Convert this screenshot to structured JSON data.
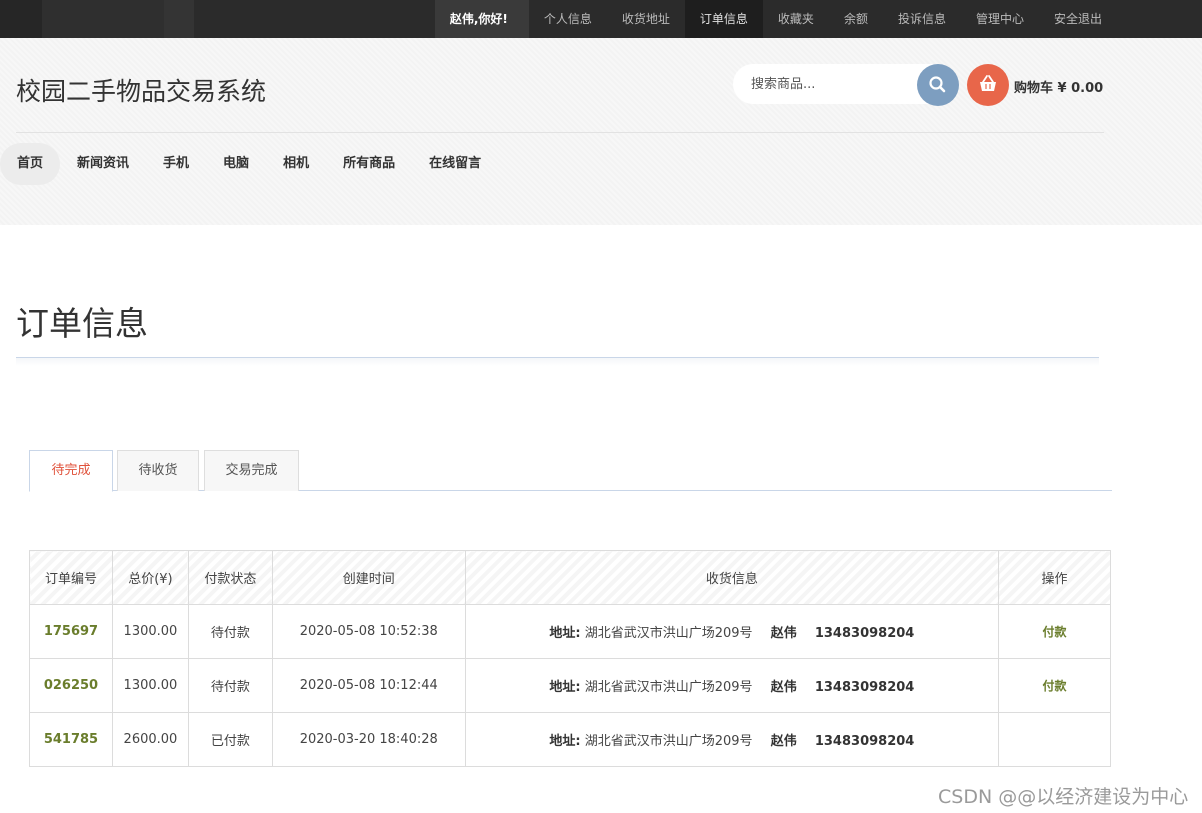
{
  "topbar": {
    "greeting": "赵伟,你好!",
    "items": [
      "个人信息",
      "收货地址",
      "订单信息",
      "收藏夹",
      "余额",
      "投诉信息",
      "管理中心",
      "安全退出"
    ],
    "active_index": 2
  },
  "header": {
    "site_title": "校园二手物品交易系统",
    "search_placeholder": "搜索商品...",
    "cart_label": "购物车 ¥ 0.00"
  },
  "mainnav": {
    "items": [
      "首页",
      "新闻资讯",
      "手机",
      "电脑",
      "相机",
      "所有商品",
      "在线留言"
    ],
    "active_index": 0
  },
  "page": {
    "title": "订单信息"
  },
  "tabs": {
    "items": [
      "待完成",
      "待收货",
      "交易完成"
    ],
    "active_index": 0
  },
  "table": {
    "headers": [
      "订单编号",
      "总价(¥)",
      "付款状态",
      "创建时间",
      "收货信息",
      "操作"
    ],
    "address_label": "地址:",
    "rows": [
      {
        "id": "175697",
        "total": "1300.00",
        "status": "待付款",
        "created": "2020-05-08 10:52:38",
        "address": "湖北省武汉市洪山广场209号",
        "name": "赵伟",
        "phone": "13483098204",
        "action": "付款"
      },
      {
        "id": "026250",
        "total": "1300.00",
        "status": "待付款",
        "created": "2020-05-08 10:12:44",
        "address": "湖北省武汉市洪山广场209号",
        "name": "赵伟",
        "phone": "13483098204",
        "action": "付款"
      },
      {
        "id": "541785",
        "total": "2600.00",
        "status": "已付款",
        "created": "2020-03-20 18:40:28",
        "address": "湖北省武汉市洪山广场209号",
        "name": "赵伟",
        "phone": "13483098204",
        "action": ""
      }
    ]
  },
  "watermark": "CSDN @@以经济建设为中心",
  "colors": {
    "topbar_bg": "#2b2b2b",
    "search_button": "#7d9ec0",
    "cart_button": "#e8664a",
    "active_tab_text": "#e0513a",
    "order_number": "#6a7d2c"
  },
  "icons": {
    "search_button": "search-icon",
    "cart_button": "basket-icon"
  }
}
